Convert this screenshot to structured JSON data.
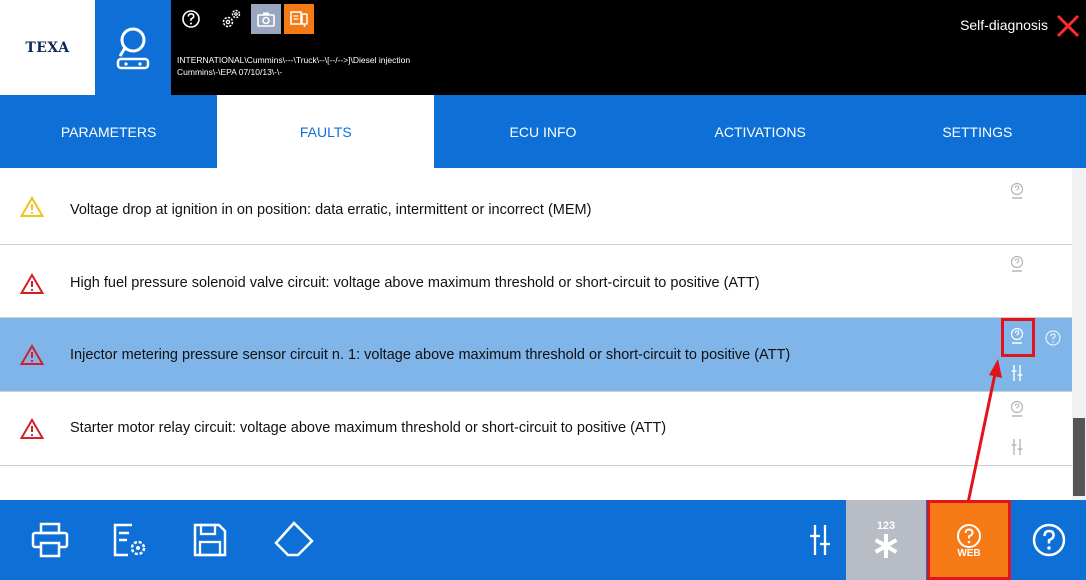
{
  "brand": {
    "logo_text": "TEXA"
  },
  "header": {
    "breadcrumb_line1": "INTERNATIONAL\\Cummins\\---\\Truck\\--\\[--/-->]\\Diesel injection",
    "breadcrumb_line2": "Cummins\\-\\EPA 07/10/13\\-\\-",
    "mode_title": "Self-diagnosis"
  },
  "tabs": [
    {
      "label": "PARAMETERS",
      "active": false
    },
    {
      "label": "FAULTS",
      "active": true
    },
    {
      "label": "ECU INFO",
      "active": false
    },
    {
      "label": "ACTIVATIONS",
      "active": false
    },
    {
      "label": "SETTINGS",
      "active": false
    }
  ],
  "faults": [
    {
      "text": "Voltage drop at ignition in on position: data erratic, intermittent or incorrect (MEM)",
      "severity": "memorized",
      "selected": false
    },
    {
      "text": "High fuel pressure solenoid valve circuit: voltage above maximum threshold or short-circuit to positive (ATT)",
      "severity": "active",
      "selected": false
    },
    {
      "text": "Injector metering pressure sensor circuit n. 1: voltage above maximum threshold or short-circuit to positive (ATT)",
      "severity": "active",
      "selected": true
    },
    {
      "text": "Starter motor relay circuit: voltage above maximum threshold or short-circuit to positive (ATT)",
      "severity": "active",
      "selected": false
    }
  ],
  "toolbar": {
    "freeze_count": "123",
    "web_label": "WEB"
  },
  "icons": {
    "home": "diagnosis-home-icon",
    "help": "help-circle-icon",
    "gear": "gears-icon",
    "camera": "camera-icon",
    "ecu": "ecu-connect-icon",
    "close": "close-x-icon",
    "warning_memorized": "warning-yellow-icon",
    "warning_active": "warning-red-icon",
    "web_help": "web-help-icon",
    "parameters": "parameters-icon",
    "print": "printer-icon",
    "config": "config-icon",
    "save": "save-icon",
    "erase": "eraser-icon",
    "freeze": "asterisk-icon"
  },
  "colors": {
    "accent_blue": "#0e6fd6",
    "selected_row": "#7fb5e8",
    "orange": "#f57a15",
    "highlight_red": "#e3131b",
    "warning_yellow": "#f2c21b",
    "warning_red": "#d21f2a"
  }
}
